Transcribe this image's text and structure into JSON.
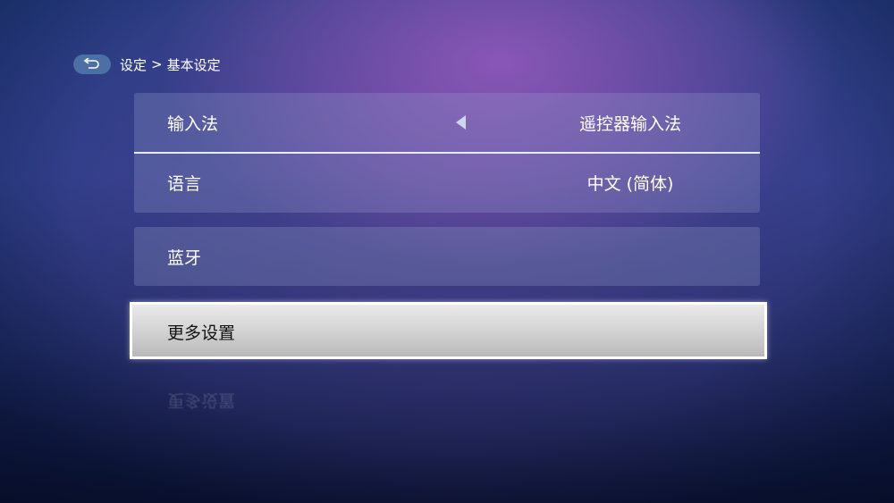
{
  "header": {
    "back_icon": "return-arrow-icon",
    "breadcrumb": {
      "parent": "设定",
      "separator": ">",
      "current": "基本设定"
    }
  },
  "settings_group_1": {
    "items": [
      {
        "label": "输入法",
        "value": "遥控器输入法",
        "has_left_arrow": true
      },
      {
        "label": "语言",
        "value": "中文 (简体)"
      }
    ]
  },
  "settings_group_2": {
    "items": [
      {
        "label": "蓝牙"
      }
    ]
  },
  "focused_item": {
    "label": "更多设置"
  },
  "colors": {
    "focus_border": "#ffffff",
    "panel_bg": "rgba(150,160,205,0.28)",
    "back_button": "#4c6fa6"
  }
}
